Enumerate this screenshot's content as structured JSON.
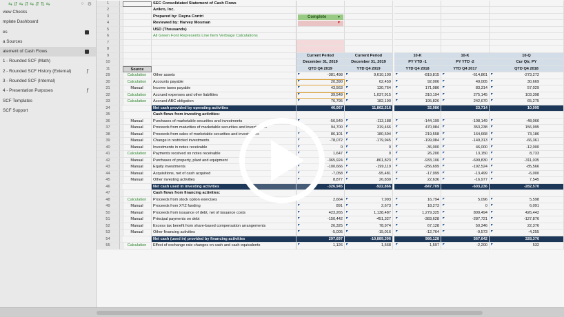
{
  "sidebar": {
    "items": [
      {
        "label": "view Checks",
        "flag": "",
        "selected": false
      },
      {
        "label": "mplate Dashboard",
        "flag": "",
        "selected": false
      },
      {
        "label": "es",
        "flag": "dark",
        "selected": false
      },
      {
        "label": "a Sources",
        "flag": "",
        "selected": false
      },
      {
        "label": "atement of Cash Flows",
        "flag": "dark",
        "selected": true
      },
      {
        "label": "1 - Rounded SCF (Math)",
        "flag": "",
        "selected": false
      },
      {
        "label": "2 - Rounded SCF History (External)",
        "flag": "ƒ",
        "selected": false
      },
      {
        "label": "3 - Rounded SCF (Internal)",
        "flag": "",
        "selected": false
      },
      {
        "label": "4 - Presentation Purposes",
        "flag": "ƒ",
        "selected": false
      },
      {
        "label": "SCF Templates",
        "flag": "",
        "selected": false
      },
      {
        "label": "SCF Support",
        "flag": "",
        "selected": false
      }
    ]
  },
  "meta": {
    "title": "SEC Consolidated Statement of Cash Flows",
    "company": "Avikro, Inc.",
    "prepared_by": "Prepared by: Dayna Contri",
    "reviewed_by": "Reviewed by: Harvey Mosman",
    "units": "USD (Thousands)",
    "note": "All Green Font Represents Line Item Verbiage Calculations",
    "status": "Complete"
  },
  "headers": {
    "source": "Source",
    "columns": [
      {
        "l1": "Current Period",
        "l2": "December 31, 2019",
        "l3": "QTD Q4 2019"
      },
      {
        "l1": "Current Period",
        "l2": "December 31, 2019",
        "l3": "YTD Q4 2019"
      },
      {
        "l1": "10-K",
        "l2": "PY YTD -1",
        "l3": "YTD Q4 2018"
      },
      {
        "l1": "10-K",
        "l2": "PY YTD -2",
        "l3": "YTD Q4 2017"
      },
      {
        "l1": "10-Q",
        "l2": "Cur Qtr, PY",
        "l3": "QTD Q4 2018"
      }
    ]
  },
  "rows": [
    {
      "n": "29",
      "src": "Calculation",
      "label": "Other assets",
      "v": [
        "-381,498",
        "9,610,100",
        "-819,815",
        "-614,861",
        "-273,272"
      ],
      "type": "data"
    },
    {
      "n": "30",
      "src": "Calculation",
      "label": "Accounts payable",
      "v": [
        "20,390",
        "62,459",
        "92,006",
        "49,005",
        "30,669"
      ],
      "type": "data"
    },
    {
      "n": "31",
      "src": "Manual",
      "label": "Income taxes payable",
      "v": [
        "43,563",
        "130,764",
        "171,086",
        "83,314",
        "57,029"
      ],
      "type": "data"
    },
    {
      "n": "32",
      "src": "Calculation",
      "label": "Accrued expenses and other liabilities",
      "v": [
        "39,549",
        "1,037,915",
        "310,194",
        "275,145",
        "103,398"
      ],
      "type": "data"
    },
    {
      "n": "33",
      "src": "Calculation",
      "label": "Accrued ABC obligation",
      "v": [
        "76,795",
        "182,190",
        "195,826",
        "242,670",
        "65,275"
      ],
      "type": "data"
    },
    {
      "n": "34",
      "src": "",
      "label": "Net cash provided by operating activities",
      "v": [
        "46,067",
        "11,862,516",
        "32,986",
        "23,714",
        "10,995"
      ],
      "type": "total"
    },
    {
      "n": "35",
      "src": "",
      "label": "Cash flows from investing activities:",
      "v": [
        "",
        "",
        "",
        "",
        ""
      ],
      "type": "section"
    },
    {
      "n": "36",
      "src": "Manual",
      "label": "Purchases of marketable securities and investments",
      "v": [
        "-56,549",
        "-113,188",
        "-144,199",
        "-108,149",
        "-48,066"
      ],
      "type": "data"
    },
    {
      "n": "37",
      "src": "Manual",
      "label": "Proceeds from maturities of marketable securities and investments",
      "v": [
        "94,700",
        "319,466",
        "470,984",
        "353,238",
        "156,995"
      ],
      "type": "data"
    },
    {
      "n": "38",
      "src": "Manual",
      "label": "Proceeds from sales of marketable securities and investments",
      "v": [
        "86,101",
        "180,594",
        "219,558",
        "164,668",
        "73,186"
      ],
      "type": "data"
    },
    {
      "n": "39",
      "src": "Manual",
      "label": "Change in restricted investments",
      "v": [
        "-78,072",
        "-179,945",
        "-199,084",
        "-149,313",
        "-66,361"
      ],
      "type": "data"
    },
    {
      "n": "40",
      "src": "Manual",
      "label": "Investments in notes receivable",
      "v": [
        "0",
        "0",
        "-36,000",
        "46,000",
        "-12,000"
      ],
      "type": "data"
    },
    {
      "n": "41",
      "src": "Calculation",
      "label": "Payments received on notes receivable",
      "v": [
        "1,647",
        "0",
        "26,200",
        "13,150",
        "8,733"
      ],
      "type": "data"
    },
    {
      "n": "42",
      "src": "Manual",
      "label": "Purchases of property, plant and equipment",
      "v": [
        "-365,924",
        "-861,823",
        "-933,106",
        "-699,830",
        "-311,035"
      ],
      "type": "data"
    },
    {
      "n": "43",
      "src": "Manual",
      "label": "Equity investments",
      "v": [
        "-100,666",
        "-199,119",
        "-256,699",
        "-192,524",
        "-85,566"
      ],
      "type": "data"
    },
    {
      "n": "44",
      "src": "Manual",
      "label": "Acquisitions, net of cash acquired",
      "v": [
        "-7,058",
        "-95,481",
        "-17,999",
        "-13,499",
        "-6,000"
      ],
      "type": "data"
    },
    {
      "n": "45",
      "src": "Manual",
      "label": "Other investing activities",
      "v": [
        "8,877",
        "26,830",
        "22,636",
        "-16,977",
        "7,545"
      ],
      "type": "data"
    },
    {
      "n": "46",
      "src": "",
      "label": "Net cash used in investing activities",
      "v": [
        "-326,945",
        "-922,866",
        "-847,709",
        "-603,236",
        "-282,570"
      ],
      "type": "total"
    },
    {
      "n": "47",
      "src": "",
      "label": "Cash flows from financing activities:",
      "v": [
        "",
        "",
        "",
        "",
        ""
      ],
      "type": "section"
    },
    {
      "n": "48",
      "src": "Calculation",
      "label": "Proceeds from stock option exercises",
      "v": [
        "2,664",
        "7,993",
        "16,794",
        "5,096",
        "5,598"
      ],
      "type": "data"
    },
    {
      "n": "49",
      "src": "Manual",
      "label": "Proceeds from XYZ funding",
      "v": [
        "891",
        "2,673",
        "18,273",
        "0",
        "6,091"
      ],
      "type": "data"
    },
    {
      "n": "50",
      "src": "Manual",
      "label": "Proceeds from issuance of debt, net of issuance costs",
      "v": [
        "423,265",
        "1,138,487",
        "1,279,325",
        "809,494",
        "426,442"
      ],
      "type": "data"
    },
    {
      "n": "51",
      "src": "Manual",
      "label": "Principal payments on debt",
      "v": [
        "-150,442",
        "-451,327",
        "-383,628",
        "-287,721",
        "-127,876"
      ],
      "type": "data"
    },
    {
      "n": "52",
      "src": "Manual",
      "label": "Excess tax benefit from share-based compensation arrangements",
      "v": [
        "26,325",
        "78,974",
        "67,128",
        "50,346",
        "22,376"
      ],
      "type": "data"
    },
    {
      "n": "53",
      "src": "Manual",
      "label": "Other financing activities",
      "v": [
        "-5,005",
        "-15,016",
        "-12,764",
        "-9,573",
        "-4,255"
      ],
      "type": "data"
    },
    {
      "n": "54",
      "src": "",
      "label": "Net cash (used in) provided by financing activities",
      "v": [
        "297,697",
        "-10,889,396",
        "986,128",
        "567,642",
        "328,376"
      ],
      "type": "total"
    },
    {
      "n": "55",
      "src": "Calculation",
      "label": "Effect of exchange rate changes on cash and cash equivalents",
      "v": [
        "1,126",
        "1,568",
        "1,597",
        "-2,200",
        "532"
      ],
      "type": "data"
    }
  ],
  "toolbar_glyphs": "⇆ ⇵ ⇆ ⇵ ⇆ ⇵ ⇅ ⇆",
  "colors": {
    "total_fill": "#1f3a5c",
    "status_fill": "#9fd38a",
    "calc_text": "#2e8b2e"
  }
}
